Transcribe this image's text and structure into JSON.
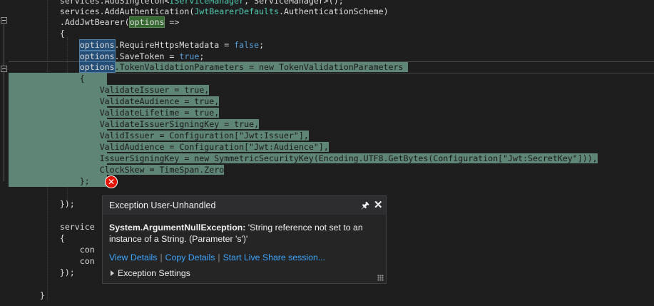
{
  "editor": {
    "lines": {
      "l0": {
        "indent": "        ",
        "pre": "services.",
        "method": "AddSingleton",
        "mid": "<",
        "typ": "IServiceManager",
        "post": ", ServiceManager>();"
      },
      "l1": {
        "indent": "        ",
        "pre": "services.AddAuthentication(",
        "typ": "JwtBearerDefaults",
        "post": ".AuthenticationScheme)"
      },
      "l2": {
        "indent": "        ",
        "pre": ".AddJwtBearer(",
        "ref": "options",
        "post": " =>"
      },
      "l3": {
        "indent": "        ",
        "text": "{"
      },
      "l4": {
        "indent": "            ",
        "ref": "options",
        "pre": ".RequireHttpsMetadata = ",
        "kw": "false",
        "post": ";"
      },
      "l5": {
        "indent": "            ",
        "ref": "options",
        "pre": ".SaveToken = ",
        "kw": "true",
        "post": ";"
      },
      "l6": {
        "indent": "            ",
        "ref": "options",
        "pre": ".TokenValidationParameters = new TokenValidationParameters "
      },
      "l7": {
        "indent": "            ",
        "text": "{"
      },
      "l8": {
        "indent": "                ",
        "text": "ValidateIssuer = true,"
      },
      "l9": {
        "indent": "                ",
        "text": "ValidateAudience = true,"
      },
      "l10": {
        "indent": "                ",
        "text": "ValidateLifetime = true,"
      },
      "l11": {
        "indent": "                ",
        "text": "ValidateIssuerSigningKey = true,"
      },
      "l12": {
        "indent": "                ",
        "text": "ValidIssuer = Configuration[\"Jwt:Issuer\"],"
      },
      "l13": {
        "indent": "                ",
        "text": "ValidAudience = Configuration[\"Jwt:Audience\"],"
      },
      "l14": {
        "indent": "                ",
        "text": "IssuerSigningKey = new SymmetricSecurityKey(Encoding.UTF8.GetBytes(Configuration[\"Jwt:SecretKey\"])),"
      },
      "l15": {
        "indent": "                ",
        "text": "ClockSkew = TimeSpan.Zero"
      },
      "l16": {
        "indent": "            ",
        "text": "};"
      },
      "l17": {
        "indent": "        ",
        "text": "});"
      },
      "l18": {
        "indent": "        ",
        "text": "service"
      },
      "l19": {
        "indent": "        ",
        "text": "{"
      },
      "l20": {
        "indent": "            ",
        "text": "con"
      },
      "l21": {
        "indent": "            ",
        "text": "con"
      },
      "l22": {
        "indent": "        ",
        "text": "});"
      },
      "l23": {
        "indent": "    ",
        "text": "}"
      }
    }
  },
  "exception_popup": {
    "title": "Exception User-Unhandled",
    "pin_icon": "pin-icon",
    "close_icon": "close-icon",
    "error_icon": "error-icon",
    "exception_type": "System.ArgumentNullException:",
    "message_line1": " 'String reference not set to an",
    "message_line2": "instance of a String. (Parameter 's')'",
    "links": {
      "view_details": "View Details",
      "copy_details": "Copy Details",
      "live_share": "Start Live Share session..."
    },
    "separator": "|",
    "settings_label": "Exception Settings",
    "error_glyph": "✕",
    "close_glyph": "✕",
    "pin_glyph": "🖈"
  },
  "colors": {
    "editor_bg": "#1e1e1e",
    "selection": "#5f8577",
    "type": "#4ec9b0",
    "keyword": "#569cd6",
    "link": "#3ea6ff",
    "error": "#e51400"
  }
}
